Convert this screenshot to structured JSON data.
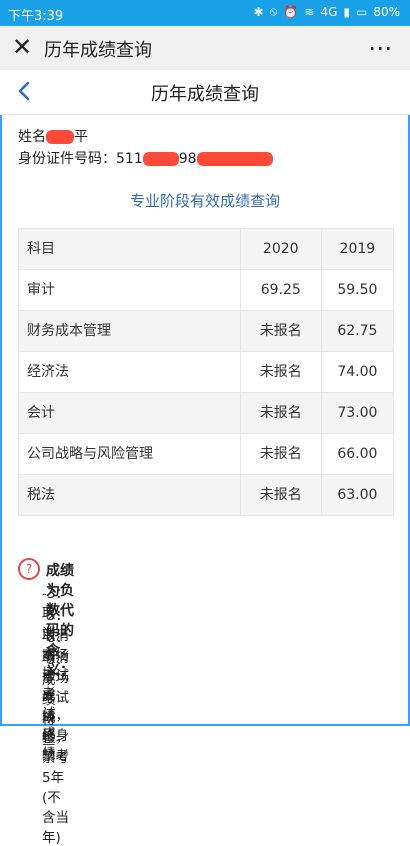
{
  "status_bar": {
    "time": "下午3:39",
    "signal": "4G",
    "battery": "80%"
  },
  "app_bar": {
    "title": "历年成绩查询"
  },
  "page_header": {
    "title": "历年成绩查询"
  },
  "info": {
    "name_label": "姓名",
    "name_visible_suffix": "平",
    "id_label": "身份证件号码：",
    "id_visible_prefix": "511",
    "id_visible_mid": "98"
  },
  "section_title": "专业阶段有效成绩查询",
  "table": {
    "headers": [
      "科目",
      "2020",
      "2019"
    ],
    "rows": [
      [
        "审计",
        "69.25",
        "59.50"
      ],
      [
        "财务成本管理",
        "未报名",
        "62.75"
      ],
      [
        "经济法",
        "未报名",
        "74.00"
      ],
      [
        "会计",
        "未报名",
        "73.00"
      ],
      [
        "公司战略与风险管理",
        "未报名",
        "66.00"
      ],
      [
        "税法",
        "未报名",
        "63.00"
      ]
    ]
  },
  "note": {
    "heading": "成绩为负数代码的含义：",
    "items": [
      "-3：取消本场考试成绩",
      "-5：取消本场考试成绩，终身禁考",
      "-8：取消本场考试成绩，禁考5年(不含当年)",
      "-9：成绩待查"
    ]
  },
  "colors": {
    "status_bar": "#1aa0e6",
    "section_title": "#2f6bb5",
    "redaction": "#ff4a3a",
    "note_icon": "#e24a4a"
  }
}
